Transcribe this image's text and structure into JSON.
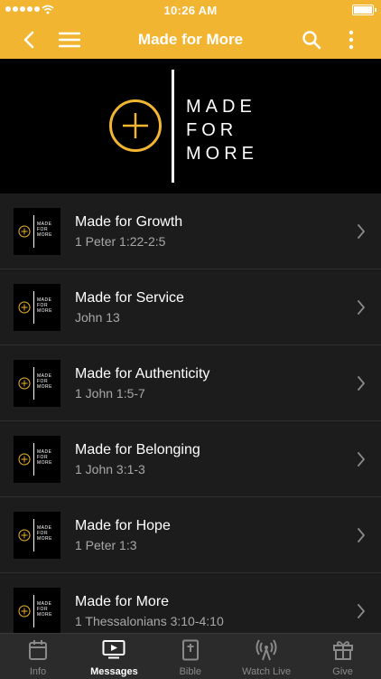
{
  "status_bar": {
    "time": "10:26 AM"
  },
  "navbar": {
    "title": "Made for More"
  },
  "hero": {
    "lines": [
      "MADE",
      "FOR",
      "MORE"
    ]
  },
  "thumb": {
    "lines": [
      "MADE",
      "FOR",
      "MORE"
    ]
  },
  "messages": [
    {
      "title": "Made for Growth",
      "reference": "1 Peter 1:22-2:5"
    },
    {
      "title": "Made for Service",
      "reference": "John 13"
    },
    {
      "title": "Made for Authenticity",
      "reference": "1 John 1:5-7"
    },
    {
      "title": "Made for Belonging",
      "reference": "1 John 3:1-3"
    },
    {
      "title": "Made for Hope",
      "reference": "1 Peter 1:3"
    },
    {
      "title": "Made for More",
      "reference": "1 Thessalonians 3:10-4:10"
    }
  ],
  "tabs": [
    {
      "label": "Info",
      "icon": "calendar-icon",
      "active": false
    },
    {
      "label": "Messages",
      "icon": "tv-icon",
      "active": true
    },
    {
      "label": "Bible",
      "icon": "bible-icon",
      "active": false
    },
    {
      "label": "Watch Live",
      "icon": "broadcast-icon",
      "active": false
    },
    {
      "label": "Give",
      "icon": "gift-icon",
      "active": false
    }
  ],
  "colors": {
    "accent": "#f2b531",
    "background": "#1c1c1c",
    "hero_background": "#000000"
  }
}
